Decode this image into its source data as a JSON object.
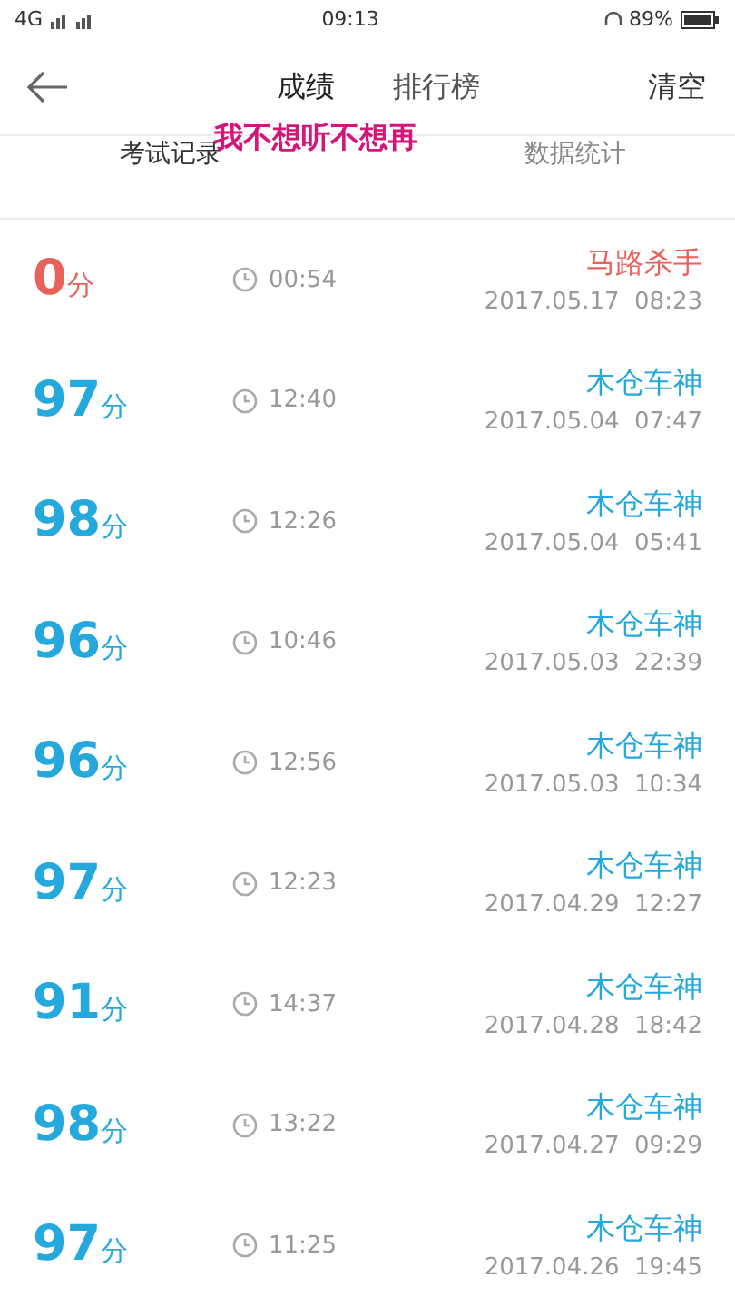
{
  "status_bar": {
    "signal": "4G",
    "time": "09:13",
    "battery": "89%"
  },
  "header": {
    "tabs": [
      {
        "label": "成绩",
        "selected": true
      },
      {
        "label": "排行榜",
        "selected": false
      }
    ],
    "action": "清空"
  },
  "caption": "我不想听不想再",
  "subtabs": [
    {
      "label": "考试记录",
      "selected": true
    },
    {
      "label": "数据统计",
      "selected": false
    }
  ],
  "records": [
    {
      "score": "0",
      "unit": "分",
      "passed": false,
      "duration": "00:54",
      "title": "马路杀手",
      "date": "2017.05.17  08:23"
    },
    {
      "score": "97",
      "unit": "分",
      "passed": true,
      "duration": "12:40",
      "title": "木仓车神",
      "date": "2017.05.04  07:47"
    },
    {
      "score": "98",
      "unit": "分",
      "passed": true,
      "duration": "12:26",
      "title": "木仓车神",
      "date": "2017.05.04  05:41"
    },
    {
      "score": "96",
      "unit": "分",
      "passed": true,
      "duration": "10:46",
      "title": "木仓车神",
      "date": "2017.05.03  22:39"
    },
    {
      "score": "96",
      "unit": "分",
      "passed": true,
      "duration": "12:56",
      "title": "木仓车神",
      "date": "2017.05.03  10:34"
    },
    {
      "score": "97",
      "unit": "分",
      "passed": true,
      "duration": "12:23",
      "title": "木仓车神",
      "date": "2017.04.29  12:27"
    },
    {
      "score": "91",
      "unit": "分",
      "passed": true,
      "duration": "14:37",
      "title": "木仓车神",
      "date": "2017.04.28  18:42"
    },
    {
      "score": "98",
      "unit": "分",
      "passed": true,
      "duration": "13:22",
      "title": "木仓车神",
      "date": "2017.04.27  09:29"
    },
    {
      "score": "97",
      "unit": "分",
      "passed": true,
      "duration": "11:25",
      "title": "木仓车神",
      "date": "2017.04.26  19:45"
    }
  ]
}
